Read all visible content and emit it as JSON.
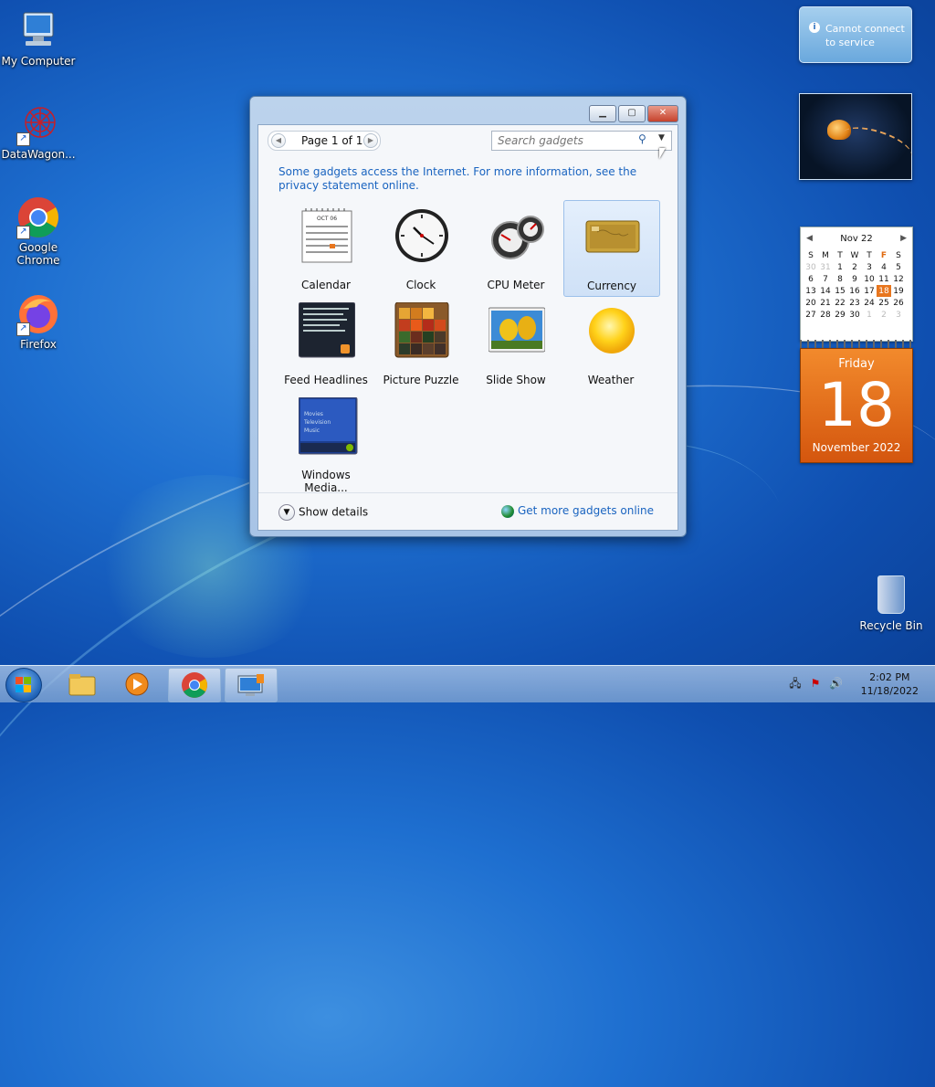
{
  "desktop": {
    "icons": [
      {
        "label": "My Computer"
      },
      {
        "label": "DataWagon..."
      },
      {
        "label": "Google Chrome"
      },
      {
        "label": "Firefox"
      }
    ],
    "recycle_bin": "Recycle Bin"
  },
  "gadget_gallery": {
    "page_indicator": "Page 1 of 1",
    "search_placeholder": "Search gadgets",
    "info_text": "Some gadgets access the Internet.  For more information, see the privacy statement online.",
    "gadgets": [
      {
        "label": "Calendar"
      },
      {
        "label": "Clock"
      },
      {
        "label": "CPU Meter"
      },
      {
        "label": "Currency",
        "selected": true
      },
      {
        "label": "Feed Headlines"
      },
      {
        "label": "Picture Puzzle"
      },
      {
        "label": "Slide Show"
      },
      {
        "label": "Weather"
      },
      {
        "label": "Windows Media..."
      }
    ],
    "show_details": "Show details",
    "get_more": "Get more gadgets online",
    "calendar_art_month": "OCT 06",
    "media_art_items": [
      "Movies",
      "Television",
      "Music"
    ]
  },
  "notification": {
    "text": "Cannot connect to service"
  },
  "calendar_gadget": {
    "month_label": "Nov 22",
    "weekdays": [
      "S",
      "M",
      "T",
      "W",
      "T",
      "F",
      "S"
    ],
    "weeks": [
      [
        "30",
        "31",
        "1",
        "2",
        "3",
        "4",
        "5"
      ],
      [
        "6",
        "7",
        "8",
        "9",
        "10",
        "11",
        "12"
      ],
      [
        "13",
        "14",
        "15",
        "16",
        "17",
        "18",
        "19"
      ],
      [
        "20",
        "21",
        "22",
        "23",
        "24",
        "25",
        "26"
      ],
      [
        "27",
        "28",
        "29",
        "30",
        "1",
        "2",
        "3"
      ]
    ],
    "today": "18",
    "weekday": "Friday",
    "month_year": "November 2022"
  },
  "taskbar": {
    "time": "2:02 PM",
    "date": "11/18/2022"
  }
}
